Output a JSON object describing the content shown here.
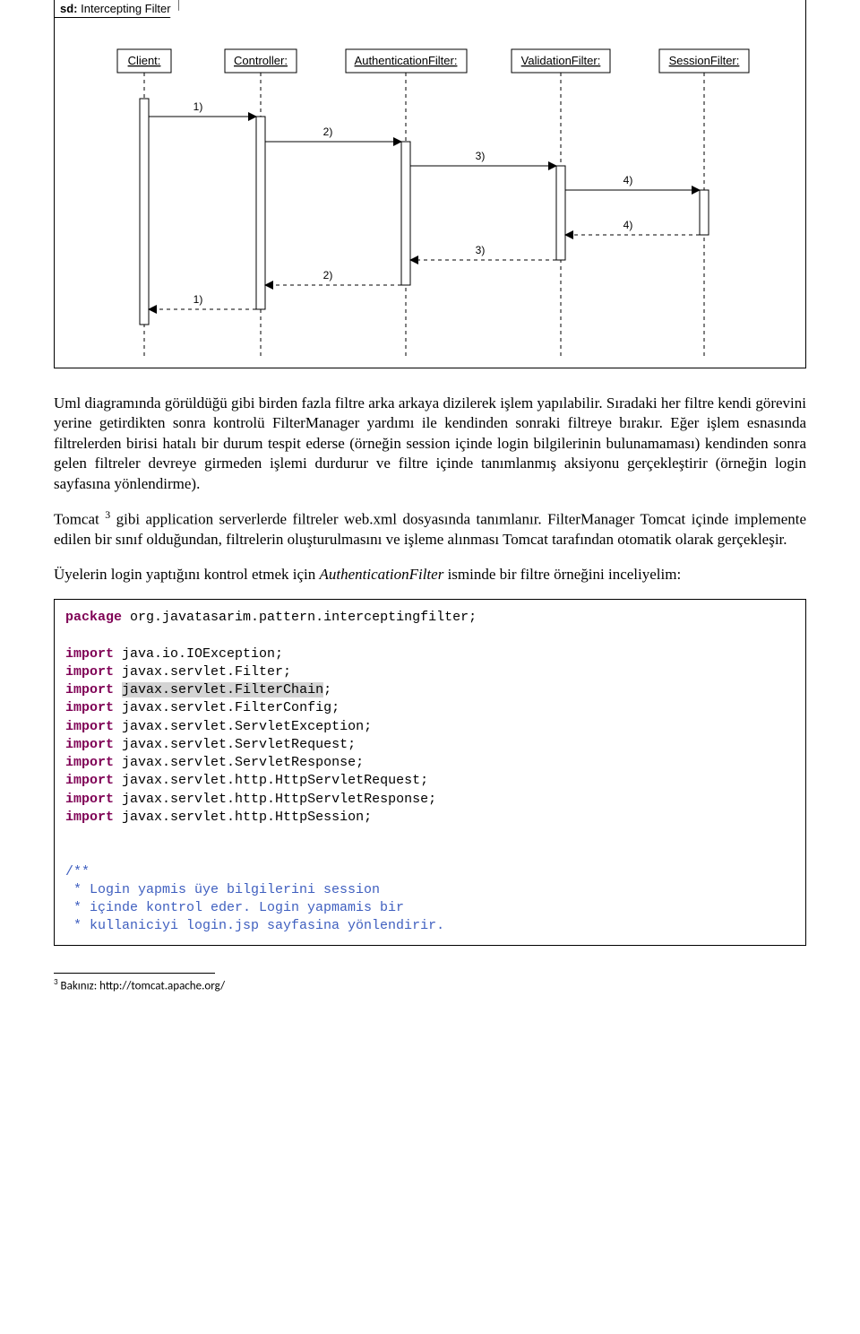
{
  "diagram": {
    "sd_tag_prefix": "sd:",
    "sd_title": "Intercepting Filter",
    "lifelines": [
      "Client:",
      "Controller:",
      "AuthenticationFilter:",
      "ValidationFilter:",
      "SessionFilter:"
    ],
    "messages_forward": [
      "1)",
      "2)",
      "3)",
      "4)"
    ],
    "messages_return": [
      "4)",
      "3)",
      "2)",
      "1)"
    ]
  },
  "paragraphs": {
    "p1": "Uml diagramında görüldüğü gibi birden fazla filtre arka arkaya dizilerek işlem yapılabilir. Sıradaki her filtre kendi görevini yerine getirdikten sonra kontrolü FilterManager yardımı ile kendinden sonraki filtreye bırakır. Eğer işlem esnasında filtrelerden birisi hatalı bir durum tespit ederse (örneğin session içinde login bilgilerinin bulunamaması) kendinden sonra gelen filtreler devreye girmeden işlemi durdurur ve filtre içinde tanımlanmış aksiyonu gerçekleştirir (örneğin login sayfasına yönlendirme).",
    "p2a": "Tomcat ",
    "p2sup": "3",
    "p2b": " gibi application serverlerde filtreler web.xml dosyasında tanımlanır. FilterManager Tomcat içinde implemente edilen bir sınıf olduğundan, filtrelerin oluşturulmasını ve işleme alınması Tomcat tarafından otomatik olarak gerçekleşir.",
    "p3a": "Üyelerin login yaptığını kontrol etmek için ",
    "p3i": "AuthenticationFilter",
    "p3b": " isminde bir filtre örneğini inceliyelim:"
  },
  "code": {
    "pkg_kw": "package",
    "pkg": "org.javatasarim.pattern.interceptingfilter;",
    "imp_kw": "import",
    "imports": [
      "java.io.IOException;",
      "javax.servlet.Filter;",
      "javax.servlet.FilterChain",
      "javax.servlet.FilterConfig;",
      "javax.servlet.ServletException;",
      "javax.servlet.ServletRequest;",
      "javax.servlet.ServletResponse;",
      "javax.servlet.http.HttpServletRequest;",
      "javax.servlet.http.HttpServletResponse;",
      "javax.servlet.http.HttpSession;"
    ],
    "comment_open": "/**",
    "comment_l1": " * Login yapmis üye bilgilerini session",
    "comment_l2": " * içinde kontrol eder. Login yapmamis bir",
    "comment_l3": " * kullaniciyi login.jsp sayfasina yönlendirir."
  },
  "footnote": {
    "num": "3",
    "text": " Bakınız: http://tomcat.apache.org/"
  }
}
